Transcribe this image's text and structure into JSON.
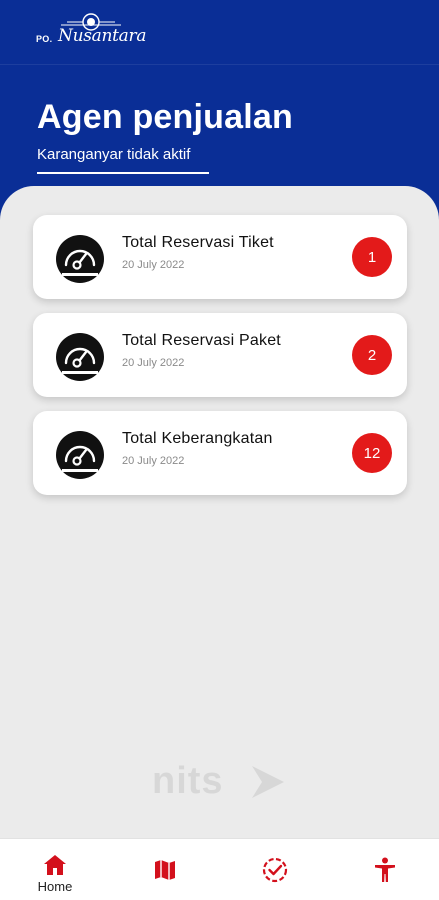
{
  "header": {
    "logo_prefix": "PO.",
    "logo_name": "Nusantara",
    "title": "Agen penjualan",
    "subtitle": "Karanganyar tidak aktif"
  },
  "cards": [
    {
      "title": "Total Reservasi Tiket",
      "date": "20 July 2022",
      "count": "1",
      "icon": "speedometer-icon"
    },
    {
      "title": "Total Reservasi Paket",
      "date": "20 July 2022",
      "count": "2",
      "icon": "speedometer-icon"
    },
    {
      "title": "Total Keberangkatan",
      "date": "20 July 2022",
      "count": "12",
      "icon": "speedometer-icon"
    }
  ],
  "watermark": "nits",
  "nav": {
    "items": [
      {
        "label": "Home",
        "icon": "home-icon",
        "active": true
      },
      {
        "label": "",
        "icon": "map-icon",
        "active": false
      },
      {
        "label": "",
        "icon": "check-circle-icon",
        "active": false
      },
      {
        "label": "",
        "icon": "accessibility-icon",
        "active": false
      }
    ]
  },
  "colors": {
    "header_bg": "#0a2e96",
    "content_bg": "#ebebeb",
    "badge": "#e31a1a",
    "nav_icon": "#d3101c"
  }
}
